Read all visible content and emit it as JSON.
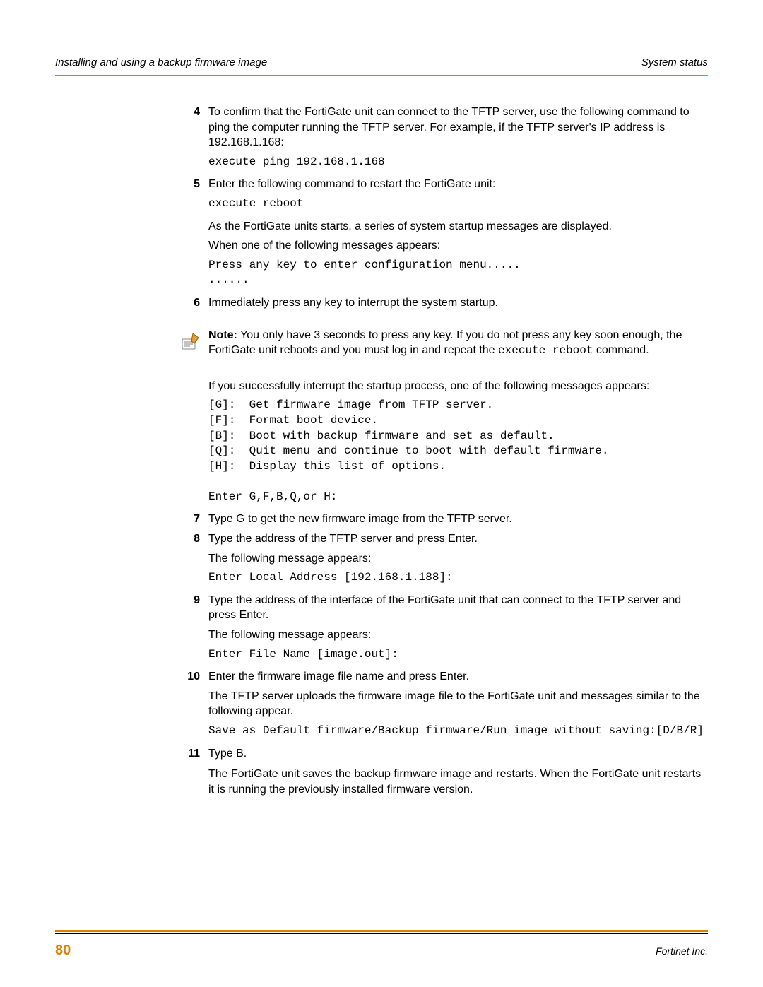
{
  "header": {
    "left": "Installing and using a backup firmware image",
    "right": "System status"
  },
  "steps": {
    "s4": {
      "num": "4",
      "text": "To confirm that the FortiGate unit can connect to the TFTP server, use the following command to ping the computer running the TFTP server. For example, if the TFTP server's IP address is 192.168.1.168:",
      "code": "execute ping 192.168.1.168"
    },
    "s5": {
      "num": "5",
      "text": "Enter the following command to restart the FortiGate unit:",
      "code": "execute reboot",
      "after1": "As the FortiGate units starts, a series of system startup messages are displayed.",
      "after2": "When one of the following messages appears:",
      "code2": "Press any key to enter configuration menu.....\n......"
    },
    "s6": {
      "num": "6",
      "text": "Immediately press any key to interrupt the system startup."
    },
    "note": {
      "label": "Note:",
      "text1": " You only have 3 seconds to press any key. If you do not press any key soon enough, the FortiGate unit reboots and you must log in and repeat the ",
      "code": "execute reboot",
      "text2": " command."
    },
    "afterNote": {
      "para": "If you successfully interrupt the startup process, one of the following messages appears:",
      "menu": "[G]:  Get firmware image from TFTP server.\n[F]:  Format boot device.\n[B]:  Boot with backup firmware and set as default.\n[Q]:  Quit menu and continue to boot with default firmware.\n[H]:  Display this list of options.\n\nEnter G,F,B,Q,or H:"
    },
    "s7": {
      "num": "7",
      "text": "Type G to get the new firmware image from the TFTP server."
    },
    "s8": {
      "num": "8",
      "text": "Type the address of the TFTP server and press Enter.",
      "after": "The following message appears:",
      "code": "Enter Local Address [192.168.1.188]:"
    },
    "s9": {
      "num": "9",
      "text": "Type the address of the interface of the FortiGate unit that can connect to the TFTP server and press Enter.",
      "after": "The following message appears:",
      "code": "Enter File Name [image.out]:"
    },
    "s10": {
      "num": "10",
      "text": "Enter the firmware image file name and press Enter.",
      "after": "The TFTP server uploads the firmware image file to the FortiGate unit and messages similar to the following appear.",
      "code": "Save as Default firmware/Backup firmware/Run image without saving:[D/B/R]"
    },
    "s11": {
      "num": "11",
      "text": "Type B.",
      "after": "The FortiGate unit saves the backup firmware image and restarts. When the FortiGate unit restarts it is running the previously installed firmware version."
    }
  },
  "footer": {
    "page": "80",
    "company": "Fortinet Inc."
  }
}
